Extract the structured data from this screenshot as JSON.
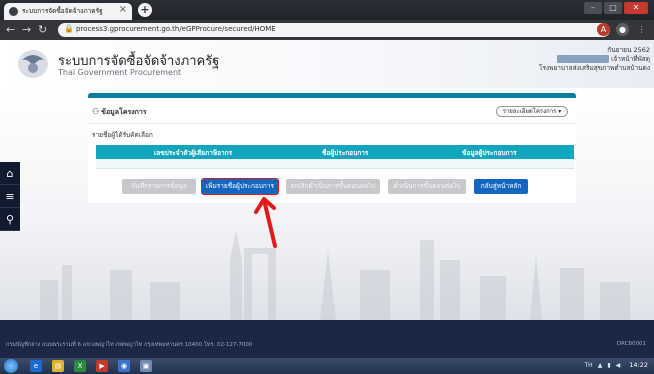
{
  "browser": {
    "tab_title": "ระบบการจัดซื้อจัดจ้างภาครัฐ",
    "new_tab_label": "+",
    "url": "process3.gprocurement.go.th/eGPProcure/secured/HOME",
    "back_icon": "arrow-left-icon",
    "forward_icon": "arrow-right-icon",
    "reload_icon": "reload-icon"
  },
  "site": {
    "title": "ระบบการจัดซื้อจัดจ้างภาครัฐ",
    "subtitle": "Thai Government Procurement",
    "date": "กันยายน 2562",
    "dept_line1": "เจ้าหน้าที่พัสดุ",
    "dept_line2": "โรงพยาบาลส่งเสริมสุขภาพตำบลบ้านดง"
  },
  "sidebar": {
    "tools": [
      {
        "name": "home-icon",
        "glyph": "⌂"
      },
      {
        "name": "menu-icon",
        "glyph": "≡"
      },
      {
        "name": "search-icon",
        "glyph": "⚲"
      }
    ]
  },
  "panel": {
    "title": "ข้อมูลโครงการ",
    "detail_button": "รายละเอียดโครงการ ▾",
    "selected_label": "รายชื่อผู้ได้รับคัดเลือก",
    "columns": [
      "เลขประจำตัวผู้เสียภาษีอากร",
      "ชื่อผู้ประกอบการ",
      "ข้อมูลผู้ประกอบการ"
    ],
    "buttons": [
      {
        "label": "บันทึกรายการข้อมูล",
        "style": "gray"
      },
      {
        "label": "เพิ่มรายชื่อผู้ประกอบการ",
        "style": "blue"
      },
      {
        "label": "ยกเลิกดำเนินการขั้นตอนต่อไป",
        "style": "gray"
      },
      {
        "label": "ดำเนินการขั้นตอนต่อไป",
        "style": "gray"
      },
      {
        "label": "กลับสู่หน้าหลัก",
        "style": "blue"
      }
    ]
  },
  "footer": {
    "text": "กรมบัญชีกลาง ถนนพระรามที่ 6 แขวงพญาไท เขตพญาไท กรุงเทพมหานคร 10400 โทร. 02-127-7000",
    "code": "DRC80001"
  },
  "taskbar": {
    "lang": "TH",
    "time": "14:22"
  },
  "colors": {
    "header_bar": "#0b7d9e",
    "table_head": "#11a6bd",
    "primary_button": "#1566c0",
    "disabled_button": "#c6c8cc",
    "annotation_arrow": "#e01b1b"
  }
}
